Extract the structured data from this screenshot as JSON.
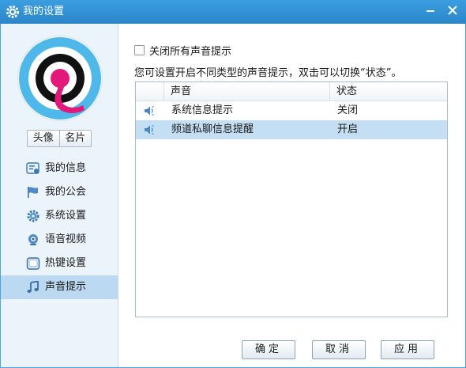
{
  "window": {
    "title": "我的设置",
    "min_icon": "minimize-icon",
    "close_icon": "close-icon"
  },
  "sidebar": {
    "avatar_button": "头像",
    "card_button": "名片",
    "items": [
      {
        "label": "我的信息",
        "icon": "profile-card-icon",
        "active": false
      },
      {
        "label": "我的公会",
        "icon": "flag-icon",
        "active": false
      },
      {
        "label": "系统设置",
        "icon": "gear-icon",
        "active": false
      },
      {
        "label": "语音视频",
        "icon": "webcam-icon",
        "active": false
      },
      {
        "label": "热键设置",
        "icon": "keyboard-key-icon",
        "active": false
      },
      {
        "label": "声音提示",
        "icon": "music-note-icon",
        "active": true
      }
    ]
  },
  "content": {
    "mute_all_label": "关闭所有声音提示",
    "mute_all_checked": false,
    "hint": "您可设置开启不同类型的声音提示，双击可以切换“状态”。",
    "table": {
      "columns": [
        "",
        "声音",
        "状态"
      ],
      "rows": [
        {
          "icon": "speaker-icon",
          "name": "系统信息提示",
          "state": "关闭",
          "selected": false
        },
        {
          "icon": "speaker-icon",
          "name": "频道私聊信息提醒",
          "state": "开启",
          "selected": true
        }
      ]
    }
  },
  "buttons": {
    "ok": "确定",
    "cancel": "取消",
    "apply": "应用"
  },
  "colors": {
    "title_bar": "#2b86c9",
    "sidebar_bg": "#ebf3fb",
    "active_item": "#bcd9f2",
    "selected_row": "#c4dff3"
  }
}
